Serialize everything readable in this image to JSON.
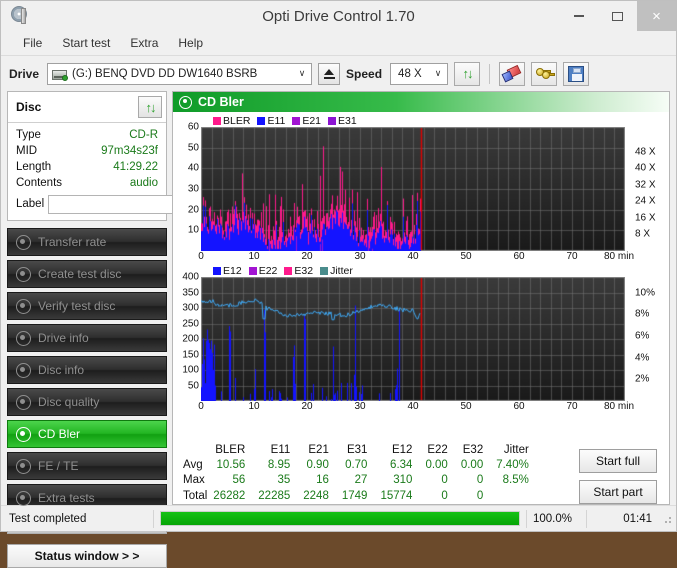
{
  "window": {
    "title": "Opti Drive Control 1.70",
    "icon": "disc-drive-icon",
    "controls": {
      "minimize": "–",
      "maximize": "□",
      "close": "×"
    }
  },
  "menubar": {
    "items": [
      "File",
      "Start test",
      "Extra",
      "Help"
    ]
  },
  "toolbar": {
    "drive_label": "Drive",
    "drive_value": "(G:)   BENQ DVD DD DW1640 BSRB",
    "eject_label": "eject-icon",
    "speed_label": "Speed",
    "speed_value": "48 X",
    "buttons": [
      "refresh-icon",
      "eraser-icon",
      "keys-icon",
      "save-icon"
    ]
  },
  "disc_panel": {
    "title": "Disc",
    "refresh_icon": "refresh-icon",
    "rows": [
      {
        "key": "Type",
        "value": "CD-R"
      },
      {
        "key": "MID",
        "value": "97m34s23f"
      },
      {
        "key": "Length",
        "value": "41:29.22"
      },
      {
        "key": "Contents",
        "value": "audio"
      }
    ],
    "label_key": "Label",
    "label_value": "",
    "label_placeholder": "",
    "disc_button_icon": "cd-icon"
  },
  "nav": {
    "items": [
      {
        "label": "Transfer rate",
        "active": false
      },
      {
        "label": "Create test disc",
        "active": false
      },
      {
        "label": "Verify test disc",
        "active": false
      },
      {
        "label": "Drive info",
        "active": false
      },
      {
        "label": "Disc info",
        "active": false
      },
      {
        "label": "Disc quality",
        "active": false
      },
      {
        "label": "CD Bler",
        "active": true
      },
      {
        "label": "FE / TE",
        "active": false
      },
      {
        "label": "Extra tests",
        "active": false
      }
    ],
    "status_window_label": "Status window > >"
  },
  "panel": {
    "title": "CD Bler",
    "icon": "disc-icon"
  },
  "actions": {
    "start_full": "Start full",
    "start_part": "Start part"
  },
  "statusbar": {
    "message": "Test completed",
    "progress_pct": "100.0%",
    "progress_value": 100,
    "elapsed": "01:41"
  },
  "stats": {
    "columns": [
      "BLER",
      "E11",
      "E21",
      "E31",
      "E12",
      "E22",
      "E32",
      "Jitter"
    ],
    "rows": [
      {
        "label": "Avg",
        "values": [
          "10.56",
          "8.95",
          "0.90",
          "0.70",
          "6.34",
          "0.00",
          "0.00",
          "7.40%"
        ]
      },
      {
        "label": "Max",
        "values": [
          "56",
          "35",
          "16",
          "27",
          "310",
          "0",
          "0",
          "8.5%"
        ]
      },
      {
        "label": "Total",
        "values": [
          "26282",
          "22285",
          "2248",
          "1749",
          "15774",
          "0",
          "0",
          ""
        ]
      }
    ]
  },
  "chart_data": [
    {
      "type": "area",
      "id": "bler-chart",
      "title": "CD Bler",
      "xlabel": "min",
      "ylabel": "",
      "xlim": [
        0,
        80
      ],
      "ylim": [
        0,
        60
      ],
      "xticks": [
        0,
        10,
        20,
        30,
        40,
        50,
        60,
        70,
        80
      ],
      "xticklabels": [
        "0",
        "10",
        "20",
        "30",
        "40",
        "50",
        "60",
        "70",
        "80 min"
      ],
      "yticks": [
        10,
        20,
        30,
        40,
        50,
        60
      ],
      "yticklabels": [
        "10",
        "20",
        "30",
        "40",
        "50",
        "60"
      ],
      "y2ticks": [
        8,
        16,
        24,
        32,
        40,
        48
      ],
      "y2ticklabels": [
        "8 X",
        "16 X",
        "24 X",
        "32 X",
        "40 X",
        "48 X"
      ],
      "y2lim": [
        0,
        60
      ],
      "grid": true,
      "plot_bg": "#2d2d2d",
      "legend_position": "top-left",
      "legend": [
        {
          "name": "BLER",
          "color": "#ff1a8c"
        },
        {
          "name": "E11",
          "color": "#1414ff"
        },
        {
          "name": "E21",
          "color": "#a214d2"
        },
        {
          "name": "E31",
          "color": "#8c14d2"
        }
      ],
      "data_end_min": 41.5,
      "marker_line_min": 41.5,
      "marker_color": "#e00000",
      "series": [
        {
          "name": "BLER",
          "color": "#ff1a8c",
          "avg": 10.56,
          "max": 56,
          "total": 26282
        },
        {
          "name": "E11",
          "color": "#1414ff",
          "avg": 8.95,
          "max": 35,
          "total": 22285
        },
        {
          "name": "E21",
          "color": "#a214d2",
          "avg": 0.9,
          "max": 16,
          "total": 2248
        },
        {
          "name": "E31",
          "color": "#8c14d2",
          "avg": 0.7,
          "max": 27,
          "total": 1749
        }
      ]
    },
    {
      "type": "area",
      "id": "e12-jitter-chart",
      "xlabel": "min",
      "ylabel": "",
      "xlim": [
        0,
        80
      ],
      "ylim": [
        0,
        400
      ],
      "xticks": [
        0,
        10,
        20,
        30,
        40,
        50,
        60,
        70,
        80
      ],
      "xticklabels": [
        "0",
        "10",
        "20",
        "30",
        "40",
        "50",
        "60",
        "70",
        "80 min"
      ],
      "yticks": [
        50,
        100,
        150,
        200,
        250,
        300,
        350,
        400
      ],
      "yticklabels": [
        "50",
        "100",
        "150",
        "200",
        "250",
        "300",
        "350",
        "400"
      ],
      "y2ticks": [
        2,
        4,
        6,
        8,
        10
      ],
      "y2ticklabels": [
        "2%",
        "4%",
        "6%",
        "8%",
        "10%"
      ],
      "y2lim": [
        0,
        11.43
      ],
      "grid": true,
      "plot_bg": "#2d2d2d",
      "legend_position": "top-left",
      "legend": [
        {
          "name": "E12",
          "color": "#1414ff"
        },
        {
          "name": "E22",
          "color": "#a214d2"
        },
        {
          "name": "E32",
          "color": "#ff1a8c"
        },
        {
          "name": "Jitter",
          "color": "#4a8c8c"
        }
      ],
      "data_end_min": 41.5,
      "marker_line_min": 41.5,
      "marker_color": "#e00000",
      "series": [
        {
          "name": "E12",
          "color": "#1414ff",
          "avg": 6.34,
          "max": 310,
          "total": 15774
        },
        {
          "name": "E22",
          "color": "#a214d2",
          "avg": 0.0,
          "max": 0,
          "total": 0
        },
        {
          "name": "E32",
          "color": "#ff1a8c",
          "avg": 0.0,
          "max": 0,
          "total": 0
        },
        {
          "name": "Jitter",
          "color": "#3fa9f5",
          "avg": "7.40%",
          "max": "8.5%",
          "band_pct": [
            7.0,
            8.5
          ]
        }
      ]
    }
  ]
}
